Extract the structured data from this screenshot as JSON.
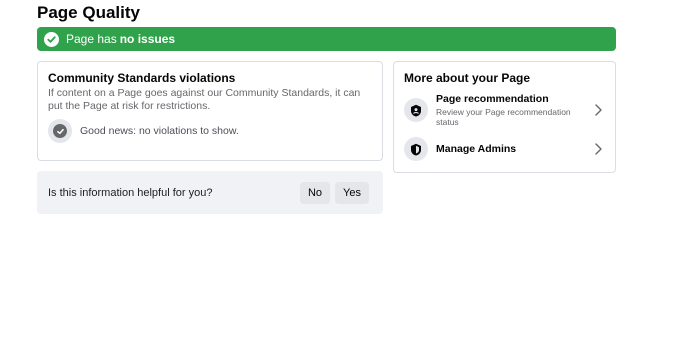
{
  "page": {
    "title": "Page Quality"
  },
  "status_banner": {
    "prefix": "Page has",
    "emphasis": "no issues",
    "color": "#31a24c"
  },
  "community_standards": {
    "title": "Community Standards violations",
    "description": "If content on a Page goes against our Community Standards, it can put the Page at risk for restrictions.",
    "good_news": "Good news: no violations to show."
  },
  "helpful": {
    "question": "Is this information helpful for you?",
    "no_label": "No",
    "yes_label": "Yes"
  },
  "more_about": {
    "title": "More about your Page",
    "items": [
      {
        "label": "Page recommendation",
        "sublabel": "Review your Page recommendation status",
        "icon": "badge-icon"
      },
      {
        "label": "Manage Admins",
        "sublabel": "",
        "icon": "shield-icon"
      }
    ]
  }
}
